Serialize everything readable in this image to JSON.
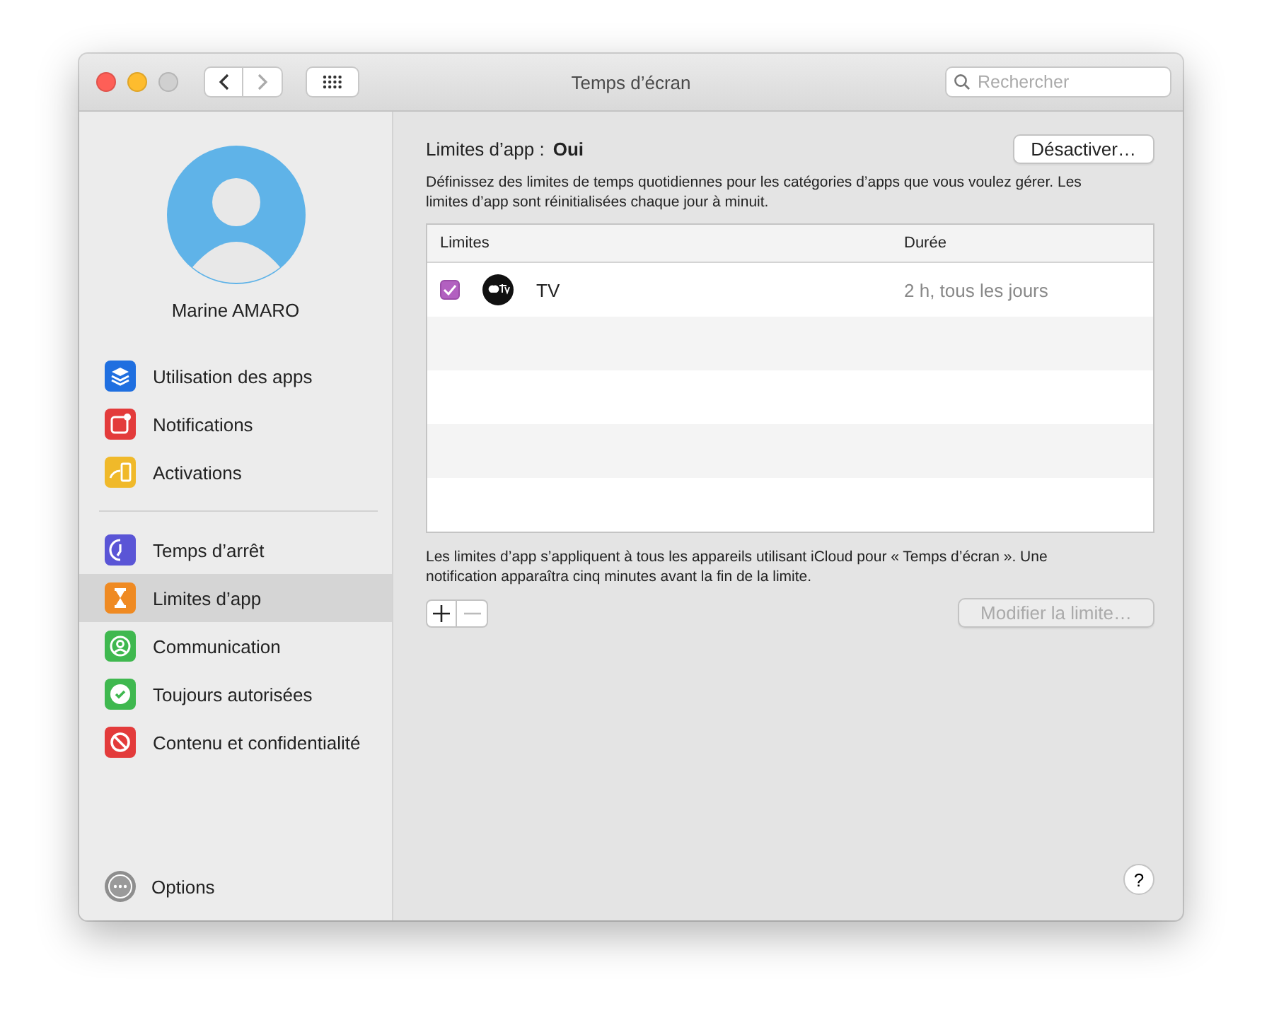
{
  "window": {
    "title": "Temps d’écran"
  },
  "toolbar": {
    "back_enabled": true,
    "forward_enabled": false,
    "search": {
      "placeholder": "Rechercher"
    }
  },
  "sidebar": {
    "user_name": "Marine AMARO",
    "groups": [
      [
        {
          "label": "Utilisation des apps",
          "kind": "layers",
          "color": "#1f6fe0",
          "selected": false
        },
        {
          "label": "Notifications",
          "kind": "notification",
          "color": "#e33b3b",
          "selected": false
        },
        {
          "label": "Activations",
          "kind": "pickup",
          "color": "#f0b92a",
          "selected": false
        }
      ],
      [
        {
          "label": "Temps d’arrêt",
          "kind": "downtime",
          "color": "#5a55d6",
          "selected": false
        },
        {
          "label": "Limites d’app",
          "kind": "hourglass",
          "color": "#ef8a22",
          "selected": true
        },
        {
          "label": "Communication",
          "kind": "person",
          "color": "#3fb84f",
          "selected": false
        },
        {
          "label": "Toujours autorisées",
          "kind": "check",
          "color": "#3fb84f",
          "selected": false
        },
        {
          "label": "Contenu et confidentialité",
          "kind": "forbidden",
          "color": "#e33b3b",
          "selected": false
        }
      ]
    ],
    "options": {
      "label": "Options"
    }
  },
  "main": {
    "status_label": "Limites d’app :",
    "status_value": "Oui",
    "disable_button": "Désactiver…",
    "description": "Définissez des limites de temps quotidiennes pour les catégories d’apps que vous voulez gérer. Les limites d’app sont réinitialisées chaque jour à minuit.",
    "table": {
      "columns": [
        "Limites",
        "Durée"
      ],
      "rows": [
        {
          "checked": true,
          "app": "TV",
          "duration": "2 h, tous les jours"
        }
      ]
    },
    "note": "Les limites d’app s’appliquent à tous les appareils utilisant iCloud pour « Temps d’écran ». Une notification apparaîtra cinq minutes avant la fin de la limite.",
    "add_enabled": true,
    "remove_enabled": false,
    "modify_button": {
      "label": "Modifier la limite…",
      "disabled": true
    },
    "help_button": "?"
  }
}
